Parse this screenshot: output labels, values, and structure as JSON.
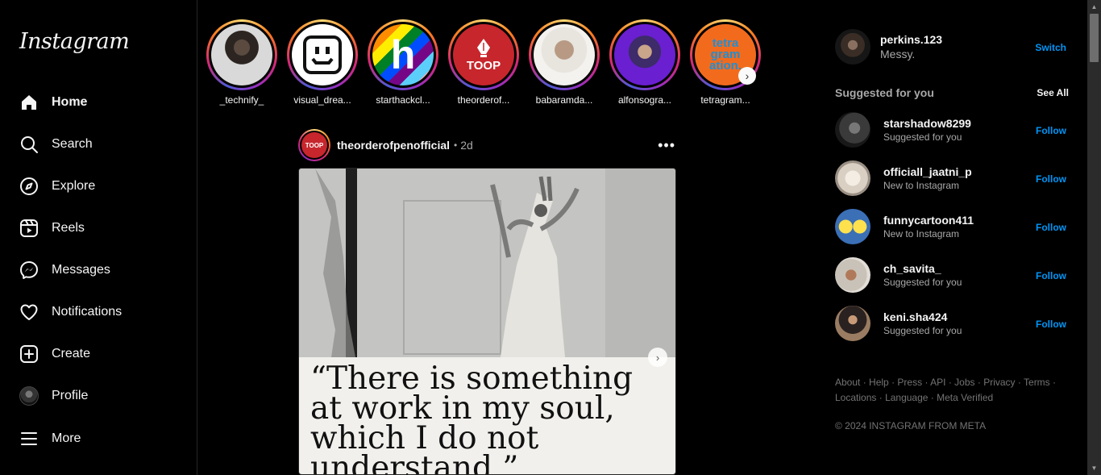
{
  "app": {
    "logo_text": "Instagram"
  },
  "sidebar": {
    "items": [
      {
        "label": "Home",
        "icon": "home-icon"
      },
      {
        "label": "Search",
        "icon": "search-icon"
      },
      {
        "label": "Explore",
        "icon": "compass-icon"
      },
      {
        "label": "Reels",
        "icon": "reels-icon"
      },
      {
        "label": "Messages",
        "icon": "messenger-icon"
      },
      {
        "label": "Notifications",
        "icon": "heart-icon"
      },
      {
        "label": "Create",
        "icon": "plus-square-icon"
      },
      {
        "label": "Profile",
        "icon": "avatar"
      },
      {
        "label": "More",
        "icon": "menu-icon"
      }
    ]
  },
  "stories": [
    {
      "name": "_technify_"
    },
    {
      "name": "visual_drea..."
    },
    {
      "name": "starthackcl..."
    },
    {
      "name": "theorderof..."
    },
    {
      "name": "babaramda..."
    },
    {
      "name": "alfonsogra..."
    },
    {
      "name": "tetragram..."
    }
  ],
  "story_art": {
    "theorderof": "TOOP",
    "starthackcl": "h",
    "tetragram": "tetra gram ation."
  },
  "post": {
    "username": "theorderofpenofficial",
    "separator": "•",
    "time": "2d",
    "avatar_text": "TOOP",
    "quote": "“There is something at work in my soul, which I do not understand.”"
  },
  "account": {
    "username": "perkins.123",
    "name": "Messy.",
    "switch_label": "Switch"
  },
  "suggestions": {
    "title": "Suggested for you",
    "see_all": "See All",
    "follow_label": "Follow",
    "items": [
      {
        "username": "starshadow8299",
        "reason": "Suggested for you"
      },
      {
        "username": "officiall_jaatni_p",
        "reason": "New to Instagram"
      },
      {
        "username": "funnycartoon411",
        "reason": "New to Instagram"
      },
      {
        "username": "ch_savita_",
        "reason": "Suggested for you"
      },
      {
        "username": "keni.sha424",
        "reason": "Suggested for you"
      }
    ]
  },
  "footer": {
    "links_row1": [
      "About",
      "Help",
      "Press",
      "API",
      "Jobs",
      "Privacy",
      "Terms"
    ],
    "links_row2": [
      "Locations",
      "Language",
      "Meta Verified"
    ],
    "separator": "·",
    "copyright": "© 2024 INSTAGRAM FROM META"
  },
  "colors": {
    "background": "#000000",
    "link_blue": "#0095f6",
    "muted_text": "#a8a8a8",
    "toop_red": "#c7262d"
  }
}
